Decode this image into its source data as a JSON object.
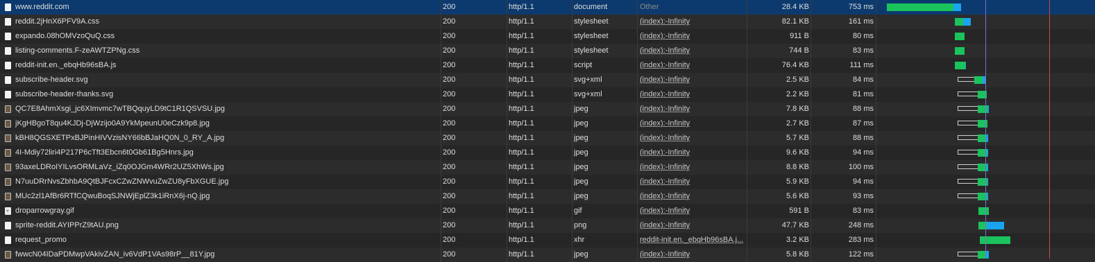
{
  "colors": {
    "waiting": "#1bc35c",
    "download": "#1aa3ee",
    "dom_content_loaded": "#7a6fd6",
    "load_event": "#c24a4a",
    "selected_row": "#0d3a6e"
  },
  "requests": [
    {
      "name": "www.reddit.com",
      "icon": "document-icon",
      "status": "200",
      "protocol": "http/1.1",
      "type": "document",
      "initiator": "Other",
      "size": "28.4 KB",
      "time": "753 ms"
    },
    {
      "name": "reddit.2jHnX6PFV9A.css",
      "icon": "document-icon",
      "status": "200",
      "protocol": "http/1.1",
      "type": "stylesheet",
      "initiator": "(index):-Infinity",
      "size": "82.1 KB",
      "time": "161 ms"
    },
    {
      "name": "expando.08hOMVzoQuQ.css",
      "icon": "document-icon",
      "status": "200",
      "protocol": "http/1.1",
      "type": "stylesheet",
      "initiator": "(index):-Infinity",
      "size": "911 B",
      "time": "80 ms"
    },
    {
      "name": "listing-comments.F-zeAWTZPNg.css",
      "icon": "document-icon",
      "status": "200",
      "protocol": "http/1.1",
      "type": "stylesheet",
      "initiator": "(index):-Infinity",
      "size": "744 B",
      "time": "83 ms"
    },
    {
      "name": "reddit-init.en._ebqHb96sBA.js",
      "icon": "document-icon",
      "status": "200",
      "protocol": "http/1.1",
      "type": "script",
      "initiator": "(index):-Infinity",
      "size": "76.4 KB",
      "time": "111 ms"
    },
    {
      "name": "subscribe-header.svg",
      "icon": "document-icon",
      "status": "200",
      "protocol": "http/1.1",
      "type": "svg+xml",
      "initiator": "(index):-Infinity",
      "size": "2.5 KB",
      "time": "84 ms"
    },
    {
      "name": "subscribe-header-thanks.svg",
      "icon": "document-icon",
      "status": "200",
      "protocol": "http/1.1",
      "type": "svg+xml",
      "initiator": "(index):-Infinity",
      "size": "2.2 KB",
      "time": "81 ms"
    },
    {
      "name": "QC7E8AhmXsgi_jc6XImvmc7wTBQquyLD9tC1R1QSVSU.jpg",
      "icon": "image-thumbnail-icon",
      "status": "200",
      "protocol": "http/1.1",
      "type": "jpeg",
      "initiator": "(index):-Infinity",
      "size": "7.8 KB",
      "time": "88 ms"
    },
    {
      "name": "jKgHBgoT8qu4KJDj-DjWzijo0A9YkMpeunU0eCzk9p8.jpg",
      "icon": "image-thumbnail-icon",
      "status": "200",
      "protocol": "http/1.1",
      "type": "jpeg",
      "initiator": "(index):-Infinity",
      "size": "2.7 KB",
      "time": "87 ms"
    },
    {
      "name": "kBH8QGSXETPxBJPinHIVVzisNY66bBJaHQ0N_0_RY_A.jpg",
      "icon": "image-thumbnail-icon",
      "status": "200",
      "protocol": "http/1.1",
      "type": "jpeg",
      "initiator": "(index):-Infinity",
      "size": "5.7 KB",
      "time": "88 ms"
    },
    {
      "name": "4I-Mdiy72liri4P217P6cTft3Ebcn6t0Gb61Bg5Hnrs.jpg",
      "icon": "image-thumbnail-icon",
      "status": "200",
      "protocol": "http/1.1",
      "type": "jpeg",
      "initiator": "(index):-Infinity",
      "size": "9.6 KB",
      "time": "94 ms"
    },
    {
      "name": "93axeLDRoIYILvsORMLaVz_iZq0OJGm4WRr2UZ5XhWs.jpg",
      "icon": "image-thumbnail-icon",
      "status": "200",
      "protocol": "http/1.1",
      "type": "jpeg",
      "initiator": "(index):-Infinity",
      "size": "8.8 KB",
      "time": "100 ms"
    },
    {
      "name": "N7uuDRrNvsZbhbA9QtBJFcxCZwZNWvuZwZU8yFbXGUE.jpg",
      "icon": "image-thumbnail-icon",
      "status": "200",
      "protocol": "http/1.1",
      "type": "jpeg",
      "initiator": "(index):-Infinity",
      "size": "5.9 KB",
      "time": "94 ms"
    },
    {
      "name": "MUc2zl1AfBr6RTfCQwuBoqSJNWjEplZ3k1iRnX6j-nQ.jpg",
      "icon": "image-thumbnail-icon",
      "status": "200",
      "protocol": "http/1.1",
      "type": "jpeg",
      "initiator": "(index):-Infinity",
      "size": "5.6 KB",
      "time": "93 ms"
    },
    {
      "name": "droparrowgray.gif",
      "icon": "gif-icon",
      "status": "200",
      "protocol": "http/1.1",
      "type": "gif",
      "initiator": "(index):-Infinity",
      "size": "591 B",
      "time": "83 ms"
    },
    {
      "name": "sprite-reddit.AYIPPrZ9tAU.png",
      "icon": "document-icon",
      "status": "200",
      "protocol": "http/1.1",
      "type": "png",
      "initiator": "(index):-Infinity",
      "size": "47.7 KB",
      "time": "248 ms"
    },
    {
      "name": "request_promo",
      "icon": "document-icon",
      "status": "200",
      "protocol": "http/1.1",
      "type": "xhr",
      "initiator": "reddit-init.en._ebqHb96sBA.j...",
      "size": "3.2 KB",
      "time": "283 ms"
    },
    {
      "name": "fwwcN04IDaPDMwpVAkivZAN_iv6VdP1VAs98rP__81Y.jpg",
      "icon": "image-thumbnail-icon",
      "status": "200",
      "protocol": "http/1.1",
      "type": "jpeg",
      "initiator": "(index):-Infinity",
      "size": "5.8 KB",
      "time": "122 ms"
    }
  ]
}
